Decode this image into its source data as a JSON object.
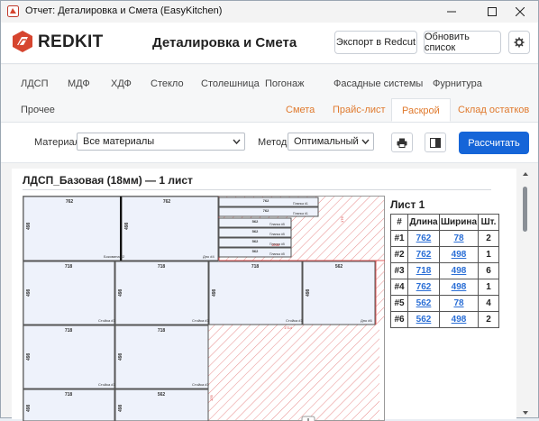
{
  "window": {
    "title": "Отчет: Деталировка и Смета (EasyKitchen)",
    "minimize_icon": "minimize-icon",
    "maximize_icon": "maximize-icon",
    "close_icon": "close-icon"
  },
  "header": {
    "brand": "REDKIT",
    "page_title": "Деталировка и Смета",
    "export_label": "Экспорт в Redcut",
    "refresh_label": "Обновить список",
    "settings_icon": "gear-icon"
  },
  "tabs": {
    "row1": [
      "ЛДСП",
      "МДФ",
      "ХДФ",
      "Стекло",
      "Столешница",
      "Погонаж",
      "Фасадные системы",
      "Фурнитура"
    ],
    "row2": [
      "Прочее"
    ],
    "right": [
      "Смета",
      "Прайс-лист",
      "Раскрой",
      "Склад остатков"
    ],
    "active": "Раскрой"
  },
  "toolbar": {
    "material_label": "Материал:",
    "material_value": "Все материалы",
    "method_label": "Метод:",
    "method_value": "Оптимальный",
    "print_icon": "print-icon",
    "panel_icon": "sidebar-panel-icon",
    "calculate_label": "Рассчитать"
  },
  "sheet": {
    "title": "ЛДСП_Базовая (18мм) — 1 лист",
    "list_title": "Лист 1",
    "columns": [
      "#",
      "Длина",
      "Ширина",
      "Шт."
    ],
    "rows": [
      [
        "#1",
        "762",
        "78",
        "2"
      ],
      [
        "#2",
        "762",
        "498",
        "1"
      ],
      [
        "#3",
        "718",
        "498",
        "6"
      ],
      [
        "#4",
        "762",
        "498",
        "1"
      ],
      [
        "#5",
        "562",
        "78",
        "4"
      ],
      [
        "#6",
        "562",
        "498",
        "2"
      ]
    ],
    "parts": {
      "top_a_w": "762",
      "top_a_h": "498",
      "top_a_lbl": "Боковина #2",
      "top_b_w": "762",
      "top_b_h": "498",
      "top_b_lbl": "Дно #4",
      "strip_w": "762",
      "strip_h": "78",
      "strip_lbl": "Планка #1",
      "strip2_w": "562",
      "strip2_h": "78",
      "strip2_lbl": "Планка #5",
      "mid_w": "718",
      "mid_h": "498",
      "mid_lbl": "Стойка #3",
      "mid4_w": "562",
      "mid4_h": "498",
      "mid4_lbl": "Дно #6",
      "waste1": "176",
      "waste2": "1268",
      "waste3": "1714",
      "waste4": "176",
      "add_icon": "plus-icon"
    }
  },
  "colors": {
    "accent": "#1565d8",
    "orange": "#e07a2e",
    "part_fill": "#eef2fb",
    "waste": "#e45a5a"
  }
}
